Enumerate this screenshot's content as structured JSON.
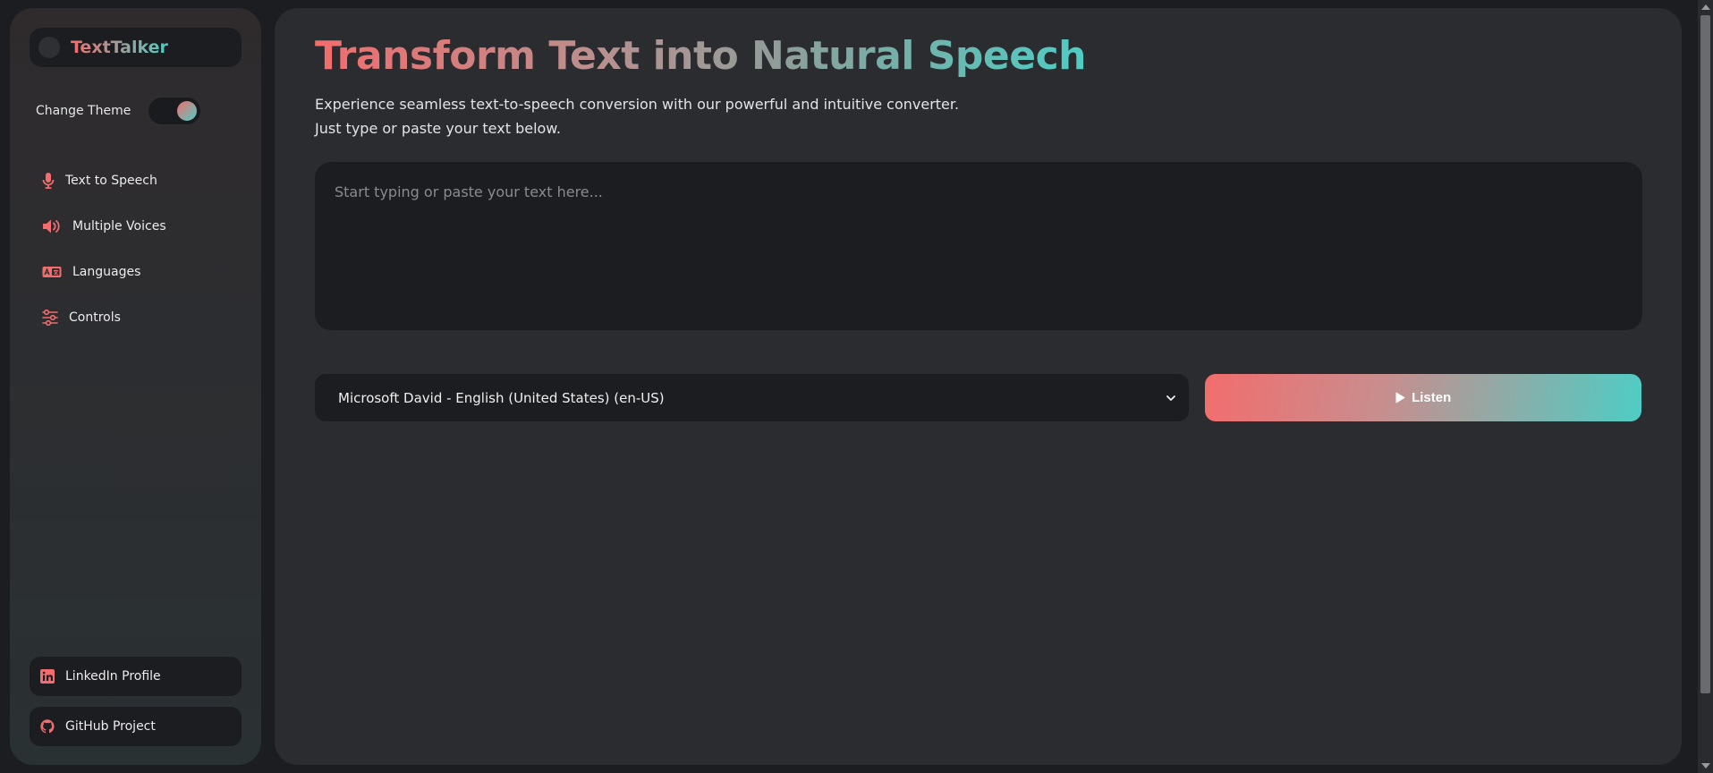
{
  "colors": {
    "coral": "#f26d6d",
    "teal": "#4ecdc4",
    "panel": "#2b2c30",
    "field": "#1c1d20"
  },
  "sidebar": {
    "brand": "TextTalker",
    "theme_label": "Change Theme",
    "nav": [
      {
        "label": "Text to Speech",
        "icon": "microphone-icon"
      },
      {
        "label": "Multiple Voices",
        "icon": "speaker-icon"
      },
      {
        "label": "Languages",
        "icon": "language-icon"
      },
      {
        "label": "Controls",
        "icon": "sliders-icon"
      }
    ],
    "links": [
      {
        "label": "LinkedIn Profile",
        "icon": "linkedin-icon"
      },
      {
        "label": "GitHub Project",
        "icon": "github-icon"
      }
    ]
  },
  "main": {
    "title": "Transform Text into Natural Speech",
    "subtitle_line1": "Experience seamless text-to-speech conversion with our powerful and intuitive converter.",
    "subtitle_line2": "Just type or paste your text below.",
    "textarea_placeholder": "Start typing or paste your text here...",
    "voice_selected": "Microsoft David - English (United States) (en-US)",
    "listen_label": "Listen"
  }
}
